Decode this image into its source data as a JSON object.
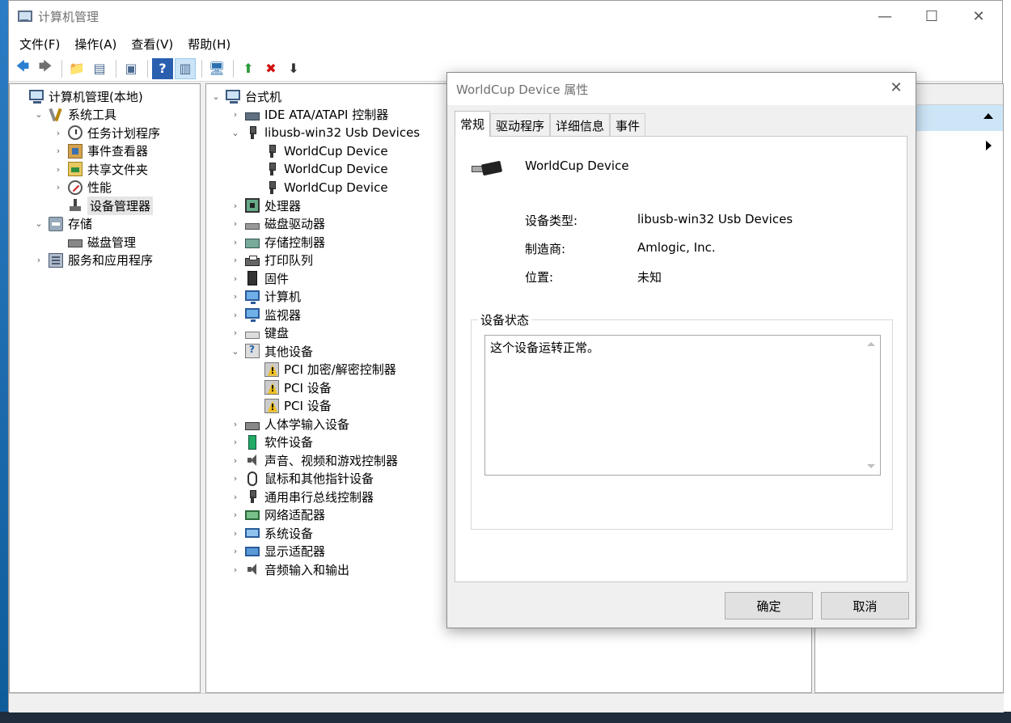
{
  "window": {
    "title": "计算机管理",
    "controls": {
      "minimize": "—",
      "maximize": "☐",
      "close": "✕"
    }
  },
  "menu": [
    {
      "label": "文件(F)"
    },
    {
      "label": "操作(A)"
    },
    {
      "label": "查看(V)"
    },
    {
      "label": "帮助(H)"
    }
  ],
  "toolbar": {
    "back": "🡄",
    "forward": "🡆",
    "up_folder": "📁",
    "show_hide": "▤",
    "properties": "▣",
    "help": "?",
    "action_pane": "▥",
    "scan": "🖥",
    "update": "⬆",
    "uninstall": "✖",
    "disable": "⬇"
  },
  "left_tree": [
    {
      "label": "计算机管理(本地)",
      "level": 0,
      "icon": "computer-icon",
      "expander": ""
    },
    {
      "label": "系统工具",
      "level": 1,
      "icon": "tools-icon",
      "expander": "v"
    },
    {
      "label": "任务计划程序",
      "level": 2,
      "icon": "clock-icon",
      "expander": ">"
    },
    {
      "label": "事件查看器",
      "level": 2,
      "icon": "event-viewer-icon",
      "expander": ">"
    },
    {
      "label": "共享文件夹",
      "level": 2,
      "icon": "shared-folder-icon",
      "expander": ">"
    },
    {
      "label": "性能",
      "level": 2,
      "icon": "performance-icon",
      "expander": ">"
    },
    {
      "label": "设备管理器",
      "level": 2,
      "icon": "device-manager-icon",
      "expander": "",
      "selected": true
    },
    {
      "label": "存储",
      "level": 1,
      "icon": "storage-icon",
      "expander": "v"
    },
    {
      "label": "磁盘管理",
      "level": 2,
      "icon": "disk-icon",
      "expander": ""
    },
    {
      "label": "服务和应用程序",
      "level": 1,
      "icon": "services-icon",
      "expander": ">"
    }
  ],
  "device_tree": [
    {
      "label": "台式机",
      "level": 0,
      "icon": "computer-icon",
      "expander": "v"
    },
    {
      "label": "IDE ATA/ATAPI 控制器",
      "level": 1,
      "icon": "ide-icon",
      "expander": ">"
    },
    {
      "label": "libusb-win32 Usb Devices",
      "level": 1,
      "icon": "usb-icon",
      "expander": "v"
    },
    {
      "label": "WorldCup Device",
      "level": 2,
      "icon": "usb-icon",
      "expander": ""
    },
    {
      "label": "WorldCup Device",
      "level": 2,
      "icon": "usb-icon",
      "expander": ""
    },
    {
      "label": "WorldCup Device",
      "level": 2,
      "icon": "usb-icon",
      "expander": ""
    },
    {
      "label": "处理器",
      "level": 1,
      "icon": "cpu-icon",
      "expander": ">"
    },
    {
      "label": "磁盘驱动器",
      "level": 1,
      "icon": "hdd-icon",
      "expander": ">"
    },
    {
      "label": "存储控制器",
      "level": 1,
      "icon": "storage-controller-icon",
      "expander": ">"
    },
    {
      "label": "打印队列",
      "level": 1,
      "icon": "printer-icon",
      "expander": ">"
    },
    {
      "label": "固件",
      "level": 1,
      "icon": "firmware-icon",
      "expander": ">"
    },
    {
      "label": "计算机",
      "level": 1,
      "icon": "monitor-icon",
      "expander": ">"
    },
    {
      "label": "监视器",
      "level": 1,
      "icon": "monitor-icon",
      "expander": ">"
    },
    {
      "label": "键盘",
      "level": 1,
      "icon": "keyboard-icon",
      "expander": ">"
    },
    {
      "label": "其他设备",
      "level": 1,
      "icon": "other-devices-icon",
      "expander": "v"
    },
    {
      "label": "PCI 加密/解密控制器",
      "level": 2,
      "icon": "warning-device-icon",
      "expander": ""
    },
    {
      "label": "PCI 设备",
      "level": 2,
      "icon": "warning-device-icon",
      "expander": ""
    },
    {
      "label": "PCI 设备",
      "level": 2,
      "icon": "warning-device-icon",
      "expander": ""
    },
    {
      "label": "人体学输入设备",
      "level": 1,
      "icon": "hid-icon",
      "expander": ">"
    },
    {
      "label": "软件设备",
      "level": 1,
      "icon": "software-device-icon",
      "expander": ">"
    },
    {
      "label": "声音、视频和游戏控制器",
      "level": 1,
      "icon": "sound-icon",
      "expander": ">"
    },
    {
      "label": "鼠标和其他指针设备",
      "level": 1,
      "icon": "mouse-icon",
      "expander": ">"
    },
    {
      "label": "通用串行总线控制器",
      "level": 1,
      "icon": "usb-icon",
      "expander": ">"
    },
    {
      "label": "网络适配器",
      "level": 1,
      "icon": "network-icon",
      "expander": ">"
    },
    {
      "label": "系统设备",
      "level": 1,
      "icon": "system-device-icon",
      "expander": ">"
    },
    {
      "label": "显示适配器",
      "level": 1,
      "icon": "display-adapter-icon",
      "expander": ">"
    },
    {
      "label": "音频输入和输出",
      "level": 1,
      "icon": "sound-icon",
      "expander": ">"
    }
  ],
  "dialog": {
    "title": "WorldCup Device 属性",
    "close": "✕",
    "tabs": [
      {
        "label": "常规",
        "active": true
      },
      {
        "label": "驱动程序"
      },
      {
        "label": "详细信息"
      },
      {
        "label": "事件"
      }
    ],
    "device_name": "WorldCup Device",
    "properties": [
      {
        "label": "设备类型:",
        "value": "libusb-win32 Usb Devices"
      },
      {
        "label": "制造商:",
        "value": "Amlogic, Inc."
      },
      {
        "label": "位置:",
        "value": "未知"
      }
    ],
    "status_group": "设备状态",
    "status_text": "这个设备运转正常。",
    "ok": "确定",
    "cancel": "取消"
  }
}
